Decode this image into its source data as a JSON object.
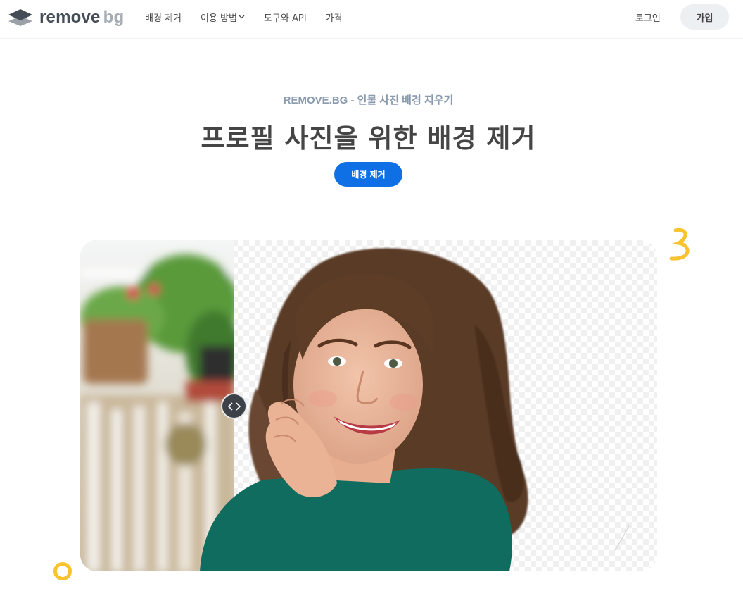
{
  "brand": {
    "word1": "remove",
    "word2": "bg"
  },
  "nav": {
    "items": [
      {
        "label": "배경 제거"
      },
      {
        "label": "이용 방법"
      },
      {
        "label": "도구와 API"
      },
      {
        "label": "가격"
      }
    ],
    "login_label": "로그인",
    "signup_label": "가입"
  },
  "hero": {
    "eyebrow": "REMOVE.BG - 인물 사진 배경 지우기",
    "title": "프로필 사진을 위한 배경 제거",
    "cta_label": "배경 제거"
  },
  "colors": {
    "accent": "#0f70e6",
    "eyebrow": "#8a9aae",
    "decoration": "#f8c32f",
    "shirt": "#0f6c5e"
  },
  "icons": {
    "logo": "layers-logo-icon",
    "nav_dropdown": "chevron-down-icon",
    "compare_handle": "left-right-arrows-icon"
  }
}
